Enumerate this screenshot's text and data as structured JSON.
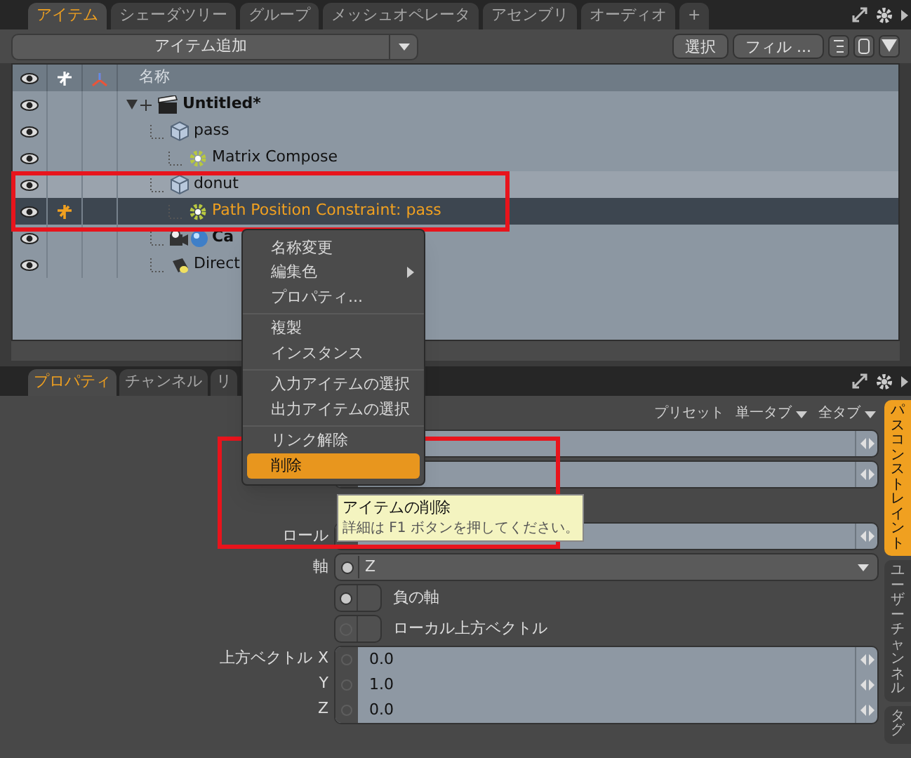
{
  "top_tabs": [
    {
      "label": "アイテム",
      "selected": true
    },
    {
      "label": "シェーダツリー",
      "selected": false
    },
    {
      "label": "グループ",
      "selected": false
    },
    {
      "label": "メッシュオペレータ",
      "selected": false
    },
    {
      "label": "アセンブリ",
      "selected": false
    },
    {
      "label": "オーディオ",
      "selected": false
    },
    {
      "label": "+",
      "selected": false
    }
  ],
  "add_item": {
    "label": "アイテム追加"
  },
  "toolbar_buttons": [
    "選択",
    "フィル ..."
  ],
  "tree": {
    "header": "名称",
    "items": [
      {
        "label": "Untitled*",
        "kind": "scene",
        "expanded": true,
        "selected": false,
        "hovered": false,
        "children": [
          {
            "label": "pass",
            "kind": "mesh",
            "selected": false,
            "hovered": false,
            "children": [
              {
                "label": "Matrix Compose",
                "kind": "modifier",
                "selected": false,
                "hovered": false
              }
            ]
          },
          {
            "label": "donut",
            "kind": "mesh",
            "selected": false,
            "hovered": true,
            "children": [
              {
                "label": "Path Position Constraint: pass",
                "kind": "modifier",
                "selected": true,
                "hovered": false
              }
            ]
          },
          {
            "label": "Ca",
            "kind": "camera",
            "selected": false,
            "hovered": false
          },
          {
            "label": "Direct",
            "kind": "light",
            "selected": false,
            "hovered": false
          }
        ]
      }
    ]
  },
  "bottom_tabs": [
    {
      "label": "プロパティ",
      "selected": true
    },
    {
      "label": "チャンネル",
      "selected": false
    },
    {
      "label": "リ",
      "selected": false
    }
  ],
  "preset_bar": [
    {
      "label": "プリセット",
      "dropdown": false
    },
    {
      "label": "単一タブ",
      "dropdown": true
    },
    {
      "label": "全タブ",
      "dropdown": true
    }
  ],
  "properties": [
    {
      "kind": "field"
    },
    {
      "kind": "field"
    },
    {
      "kind": "field",
      "label": "ロール"
    },
    {
      "kind": "dropdown",
      "label": "軸",
      "value": "Z"
    },
    {
      "kind": "toggle",
      "label": "負の軸",
      "on": true
    },
    {
      "kind": "toggle",
      "label": "ローカル上方ベクトル",
      "on": false
    },
    {
      "kind": "vector",
      "label": "上方ベクトル",
      "components": [
        {
          "axis": "X",
          "value": "0.0"
        },
        {
          "axis": "Y",
          "value": "1.0"
        },
        {
          "axis": "Z",
          "value": "0.0"
        }
      ]
    }
  ],
  "side_tabs": [
    {
      "label": "パスコンストレイント",
      "selected": true
    },
    {
      "label": "ユーザーチャンネル",
      "selected": false
    },
    {
      "label": "タグ",
      "selected": false
    }
  ],
  "context_menu": [
    {
      "kind": "item",
      "label": "名称変更",
      "submenu": false,
      "selected": false
    },
    {
      "kind": "item",
      "label": "編集色",
      "submenu": true,
      "selected": false
    },
    {
      "kind": "item",
      "label": "プロパティ...",
      "submenu": false,
      "selected": false
    },
    {
      "kind": "separator"
    },
    {
      "kind": "item",
      "label": "複製",
      "submenu": false,
      "selected": false
    },
    {
      "kind": "item",
      "label": "インスタンス",
      "submenu": false,
      "selected": false
    },
    {
      "kind": "separator"
    },
    {
      "kind": "item",
      "label": "入力アイテムの選択",
      "submenu": false,
      "selected": false
    },
    {
      "kind": "item",
      "label": "出力アイテムの選択",
      "submenu": false,
      "selected": false
    },
    {
      "kind": "separator"
    },
    {
      "kind": "item",
      "label": "リンク解除",
      "submenu": false,
      "selected": false
    },
    {
      "kind": "item",
      "label": "削除",
      "submenu": false,
      "selected": true
    }
  ],
  "tooltip": {
    "title": "アイテムの削除",
    "detail": "詳細は F1 ボタンを押してください。"
  }
}
